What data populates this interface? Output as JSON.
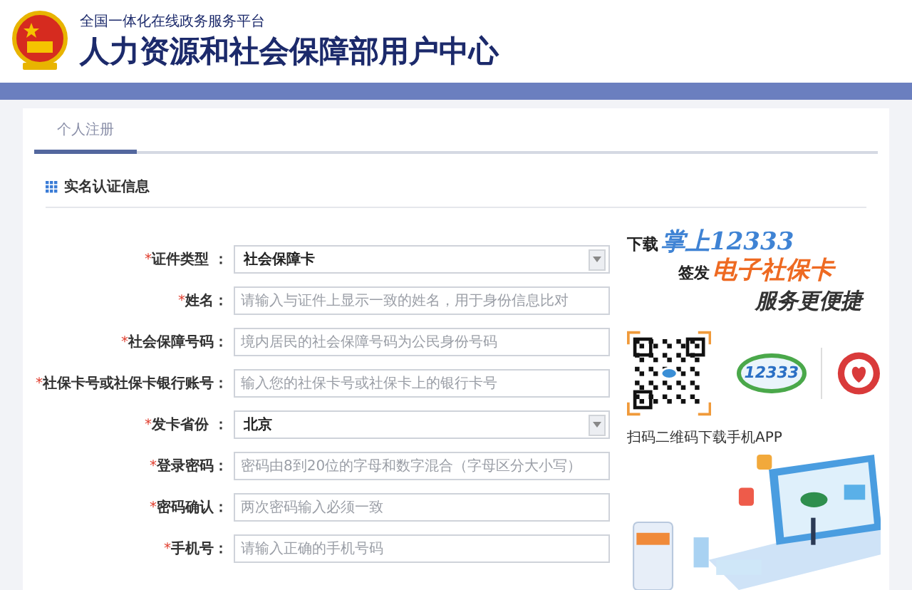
{
  "header": {
    "subtitle": "全国一体化在线政务服务平台",
    "title": "人力资源和社会保障部用户中心"
  },
  "tabs": [
    {
      "label": "个人注册",
      "selected": true
    }
  ],
  "section": {
    "title": "实名认证信息"
  },
  "form": [
    {
      "kind": "select",
      "mark": "*",
      "label": "证件类型 ：",
      "value": "社会保障卡"
    },
    {
      "kind": "input",
      "mark": "*",
      "label": "姓名：",
      "placeholder": "请输入与证件上显示一致的姓名，用于身份信息比对"
    },
    {
      "kind": "input",
      "mark": "*",
      "label": "社会保障号码：",
      "placeholder": "境内居民的社会保障号码为公民身份号码"
    },
    {
      "kind": "input",
      "mark": "*",
      "label": "社保卡号或社保卡银行账号：",
      "placeholder": "输入您的社保卡号或社保卡上的银行卡号"
    },
    {
      "kind": "select",
      "mark": "*",
      "label": "发卡省份 ：",
      "value": "北京"
    },
    {
      "kind": "input",
      "mark": "*",
      "label": "登录密码：",
      "placeholder": "密码由8到20位的字母和数字混合（字母区分大小写）"
    },
    {
      "kind": "input",
      "mark": "*",
      "label": "密码确认：",
      "placeholder": "两次密码输入必须一致"
    },
    {
      "kind": "input",
      "mark": "*",
      "label": "手机号：",
      "placeholder": "请输入正确的手机号码"
    }
  ],
  "promo": {
    "line1_prefix": "下载",
    "line1_highlight": "掌上12333",
    "line2_prefix": "签发",
    "line2_highlight": "电子社保卡",
    "line3": "服务更便捷",
    "logo_text": "12333",
    "caption": "扫码二维码下载手机APP"
  }
}
